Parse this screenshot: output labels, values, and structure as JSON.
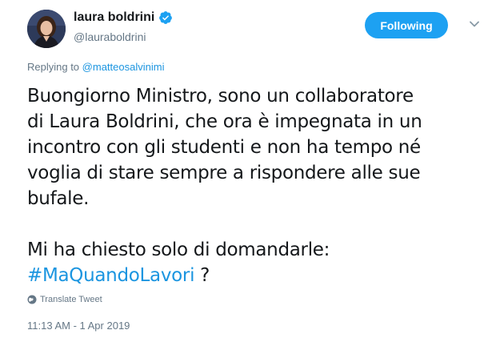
{
  "author": {
    "display_name": "laura boldrini",
    "handle": "@lauraboldrini",
    "verified": true
  },
  "follow_button": {
    "label": "Following"
  },
  "reply": {
    "prefix": "Replying to",
    "mention": "@matteosalvinimi"
  },
  "tweet": {
    "line1": "Buongiorno Ministro, sono un collaboratore",
    "line2": "di Laura Boldrini, che ora è impegnata in un",
    "line3": "incontro con gli studenti e non ha tempo né",
    "line4": "voglia di stare sempre a rispondere alle sue",
    "line5": "bufale.",
    "line6": "Mi ha chiesto solo di domandarle:",
    "hashtag": "#MaQuandoLavori",
    "suffix": " ?"
  },
  "translate_label": "Translate Tweet",
  "timestamp": "11:13 AM - 1 Apr 2019",
  "colors": {
    "accent": "#1da1f2",
    "link": "#1b95e0",
    "muted": "#657786",
    "text": "#14171a"
  },
  "icons": {
    "verified": "verified-badge-icon",
    "chevron": "chevron-down-icon",
    "globe": "globe-icon"
  }
}
